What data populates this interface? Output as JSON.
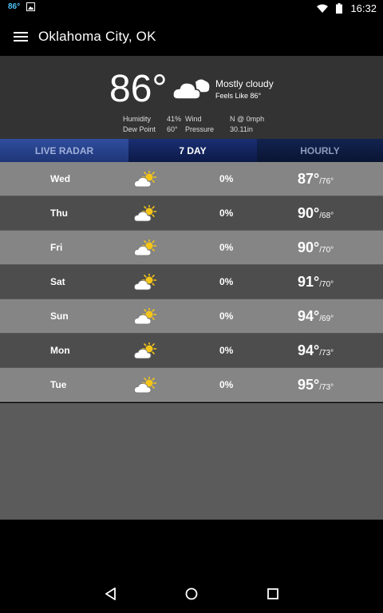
{
  "status_bar": {
    "temp": "86°",
    "time": "16:32"
  },
  "app_bar": {
    "title": "Oklahoma City, OK"
  },
  "current": {
    "temperature": "86°",
    "condition": "Mostly cloudy",
    "feels_like": "Feels Like 86°",
    "humidity_label": "Humidity",
    "humidity": "41%",
    "dew_point_label": "Dew Point",
    "dew_point": "60°",
    "wind_label": "Wind",
    "wind": "N @ 0mph",
    "pressure_label": "Pressure",
    "pressure": "30.11in",
    "icon": "cloud-icon"
  },
  "tabs": [
    {
      "label": "LIVE RADAR"
    },
    {
      "label": "7 DAY",
      "selected": true
    },
    {
      "label": "HOURLY"
    }
  ],
  "forecast": [
    {
      "day": "Wed",
      "precip": "0%",
      "high": "87°",
      "low": "/76°",
      "icon": "partly-sunny-icon"
    },
    {
      "day": "Thu",
      "precip": "0%",
      "high": "90°",
      "low": "/68°",
      "icon": "partly-sunny-icon"
    },
    {
      "day": "Fri",
      "precip": "0%",
      "high": "90°",
      "low": "/70°",
      "icon": "partly-sunny-icon"
    },
    {
      "day": "Sat",
      "precip": "0%",
      "high": "91°",
      "low": "/70°",
      "icon": "partly-sunny-icon"
    },
    {
      "day": "Sun",
      "precip": "0%",
      "high": "94°",
      "low": "/69°",
      "icon": "partly-sunny-icon"
    },
    {
      "day": "Mon",
      "precip": "0%",
      "high": "94°",
      "low": "/73°",
      "icon": "partly-sunny-icon"
    },
    {
      "day": "Tue",
      "precip": "0%",
      "high": "95°",
      "low": "/73°",
      "icon": "partly-sunny-icon"
    }
  ],
  "colors": {
    "accent": "#1a2f73",
    "row_light": "#858585",
    "row_dark": "#4d4d4d",
    "sun": "#f5c518"
  }
}
